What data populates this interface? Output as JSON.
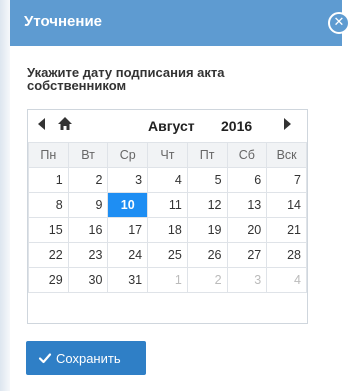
{
  "dialog": {
    "title": "Уточнение",
    "close_glyph": "✕",
    "prompt": "Укажите дату подписания акта собственником"
  },
  "calendar": {
    "month": "Август",
    "year": "2016",
    "weekdays": [
      "Пн",
      "Вт",
      "Ср",
      "Чт",
      "Пт",
      "Сб",
      "Вск"
    ],
    "weeks": [
      [
        "1",
        "2",
        "3",
        "4",
        "5",
        "6",
        "7"
      ],
      [
        "8",
        "9",
        "10",
        "11",
        "12",
        "13",
        "14"
      ],
      [
        "15",
        "16",
        "17",
        "18",
        "19",
        "20",
        "21"
      ],
      [
        "22",
        "23",
        "24",
        "25",
        "26",
        "27",
        "28"
      ],
      [
        "29",
        "30",
        "31",
        "1",
        "2",
        "3",
        "4"
      ]
    ],
    "selected_day": "10"
  },
  "actions": {
    "save_label": "Сохранить"
  },
  "colors": {
    "header": "#5e9bd1",
    "selected": "#1e8ef3",
    "button": "#2f7fc6"
  },
  "icons": {
    "close": "close-icon",
    "prev": "chevron-left-icon",
    "home": "home-icon",
    "next": "chevron-right-icon",
    "save": "checkmark-icon"
  }
}
